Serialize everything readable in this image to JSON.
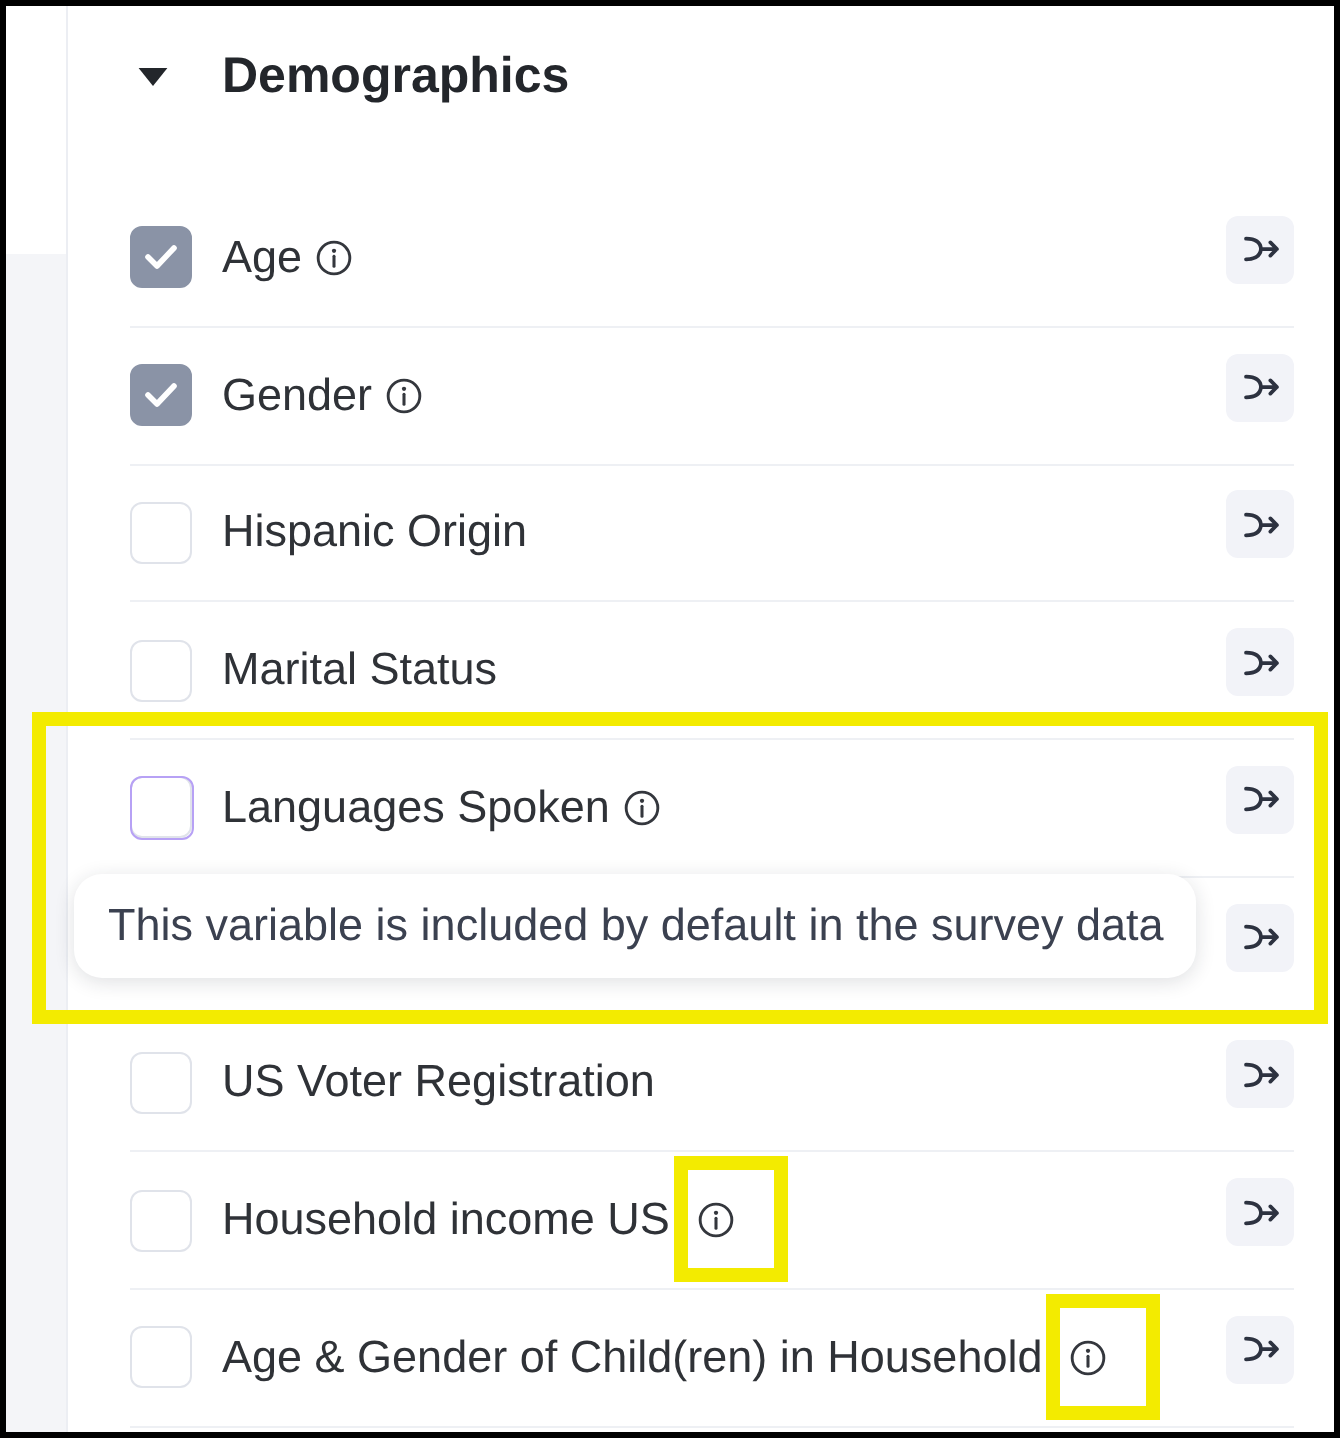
{
  "section": {
    "title": "Demographics",
    "expanded": true
  },
  "rows": [
    {
      "kind": "variable",
      "label": "Age",
      "checked": true,
      "hovered": false,
      "info": true,
      "info_highlighted": false
    },
    {
      "kind": "variable",
      "label": "Gender",
      "checked": true,
      "hovered": false,
      "info": true,
      "info_highlighted": false
    },
    {
      "kind": "variable",
      "label": "Hispanic Origin",
      "checked": false,
      "hovered": false,
      "info": false,
      "info_highlighted": false
    },
    {
      "kind": "variable",
      "label": "Marital Status",
      "checked": false,
      "hovered": false,
      "info": false,
      "info_highlighted": false
    },
    {
      "kind": "group",
      "highlighted": true,
      "rows": [
        {
          "kind": "variable",
          "label": "Languages Spoken",
          "checked": false,
          "hovered": true,
          "info": true,
          "info_highlighted": false,
          "tooltip": "This variable is included by default in the survey data"
        },
        {
          "kind": "covered"
        }
      ]
    },
    {
      "kind": "variable",
      "label": "US Voter Registration",
      "checked": false,
      "hovered": false,
      "info": false,
      "info_highlighted": false
    },
    {
      "kind": "variable",
      "label": "Household income US",
      "checked": false,
      "hovered": false,
      "info": true,
      "info_highlighted": true
    },
    {
      "kind": "variable",
      "label": "Age & Gender of Child(ren) in Household",
      "checked": false,
      "hovered": false,
      "info": true,
      "info_highlighted": true
    }
  ]
}
